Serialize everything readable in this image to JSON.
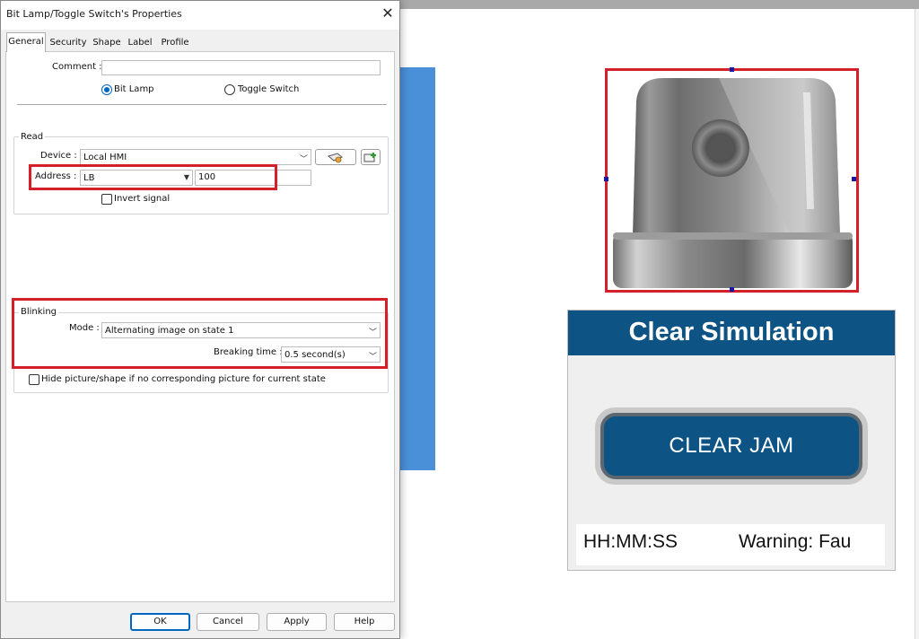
{
  "dialog": {
    "title": "Bit Lamp/Toggle Switch's Properties",
    "close_glyph": "✕",
    "tabs": [
      {
        "label": "General",
        "active": true
      },
      {
        "label": "Security"
      },
      {
        "label": "Shape"
      },
      {
        "label": "Label"
      },
      {
        "label": "Profile"
      }
    ],
    "comment": {
      "label": "Comment :",
      "value": ""
    },
    "type": {
      "bit_lamp": "Bit Lamp",
      "toggle_switch": "Toggle Switch",
      "selected": "Bit Lamp"
    },
    "read": {
      "group_label": "Read",
      "device_label": "Device :",
      "device_value": "Local HMI",
      "address_label": "Address :",
      "address_type": "LB",
      "address_value": "100",
      "invert_label": "Invert signal",
      "invert_checked": false
    },
    "blinking": {
      "group_label": "Blinking",
      "mode_label": "Mode :",
      "mode_value": "Alternating image on state 1",
      "breaking_label": "Breaking time :",
      "breaking_value": "0.5 second(s)"
    },
    "hide_label": "Hide picture/shape if no corresponding picture for current state",
    "hide_checked": false,
    "buttons": {
      "ok": "OK",
      "cancel": "Cancel",
      "apply": "Apply",
      "help": "Help"
    }
  },
  "canvas": {
    "sim_title": "Clear Simulation",
    "jam_button": "CLEAR JAM",
    "time_text": "HH:MM:SS",
    "warning_text": "Warning: Fau"
  },
  "colors": {
    "highlight": "#d4202a",
    "sim_header": "#0d5485",
    "blue_panel": "#4a90d9",
    "accent": "#0067c0"
  },
  "icons": [
    "close-icon",
    "dropdown-arrow-icon",
    "device-settings-icon",
    "add-device-icon",
    "lamp-image"
  ]
}
